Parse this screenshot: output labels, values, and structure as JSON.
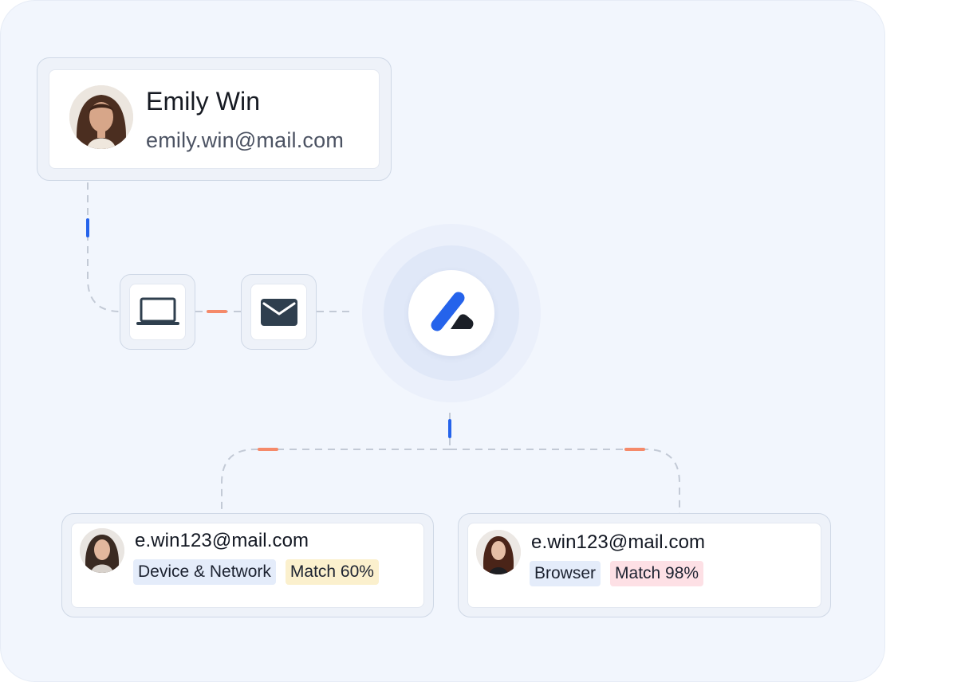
{
  "profile": {
    "name": "Emily Win",
    "email": "emily.win@mail.com"
  },
  "icons": {
    "laptop": "laptop-icon",
    "mail": "envelope-icon",
    "brand": "brand-logo-icon"
  },
  "matches": [
    {
      "email": "e.win123@mail.com",
      "tags": [
        {
          "label": "Device & Network",
          "tone": "blue"
        },
        {
          "label": "Match 60%",
          "tone": "yellow"
        }
      ]
    },
    {
      "email": "e.win123@mail.com",
      "tags": [
        {
          "label": "Browser",
          "tone": "blue"
        },
        {
          "label": "Match 98%",
          "tone": "red"
        }
      ]
    }
  ],
  "colors": {
    "panel_background": "#f2f6fd",
    "accent_blue": "#2563eb",
    "accent_orange": "#f58a6a",
    "connector_gray": "#c3cad6",
    "icon_dark": "#2f3f4e",
    "tag_blue": "#e4ecfa",
    "tag_yellow": "#fbf0cd",
    "tag_red": "#fde0e5"
  }
}
